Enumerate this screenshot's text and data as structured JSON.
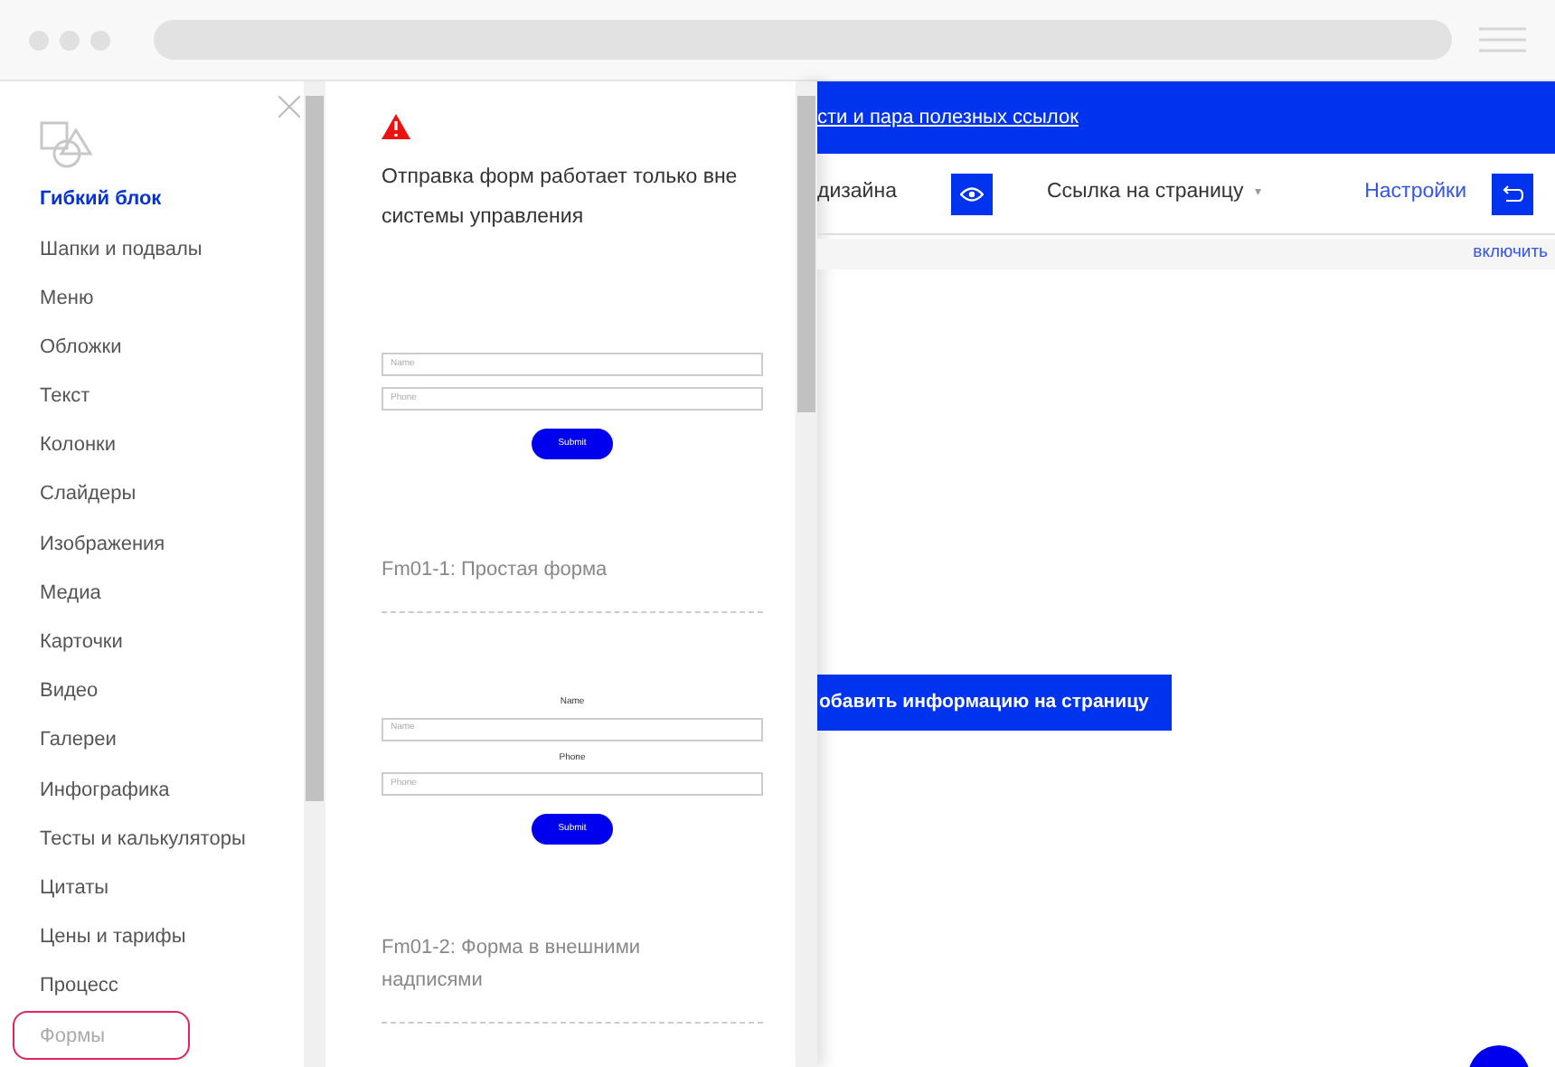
{
  "sidebar": {
    "items": [
      {
        "label": "Гибкий блок",
        "selected": true,
        "outlined": false
      },
      {
        "label": "Шапки и подвалы",
        "selected": false,
        "outlined": false
      },
      {
        "label": "Меню",
        "selected": false,
        "outlined": false
      },
      {
        "label": "Обложки",
        "selected": false,
        "outlined": false
      },
      {
        "label": "Текст",
        "selected": false,
        "outlined": false
      },
      {
        "label": "Колонки",
        "selected": false,
        "outlined": false
      },
      {
        "label": "Слайдеры",
        "selected": false,
        "outlined": false
      },
      {
        "label": "Изображения",
        "selected": false,
        "outlined": false
      },
      {
        "label": "Медиа",
        "selected": false,
        "outlined": false
      },
      {
        "label": "Карточки",
        "selected": false,
        "outlined": false
      },
      {
        "label": "Видео",
        "selected": false,
        "outlined": false
      },
      {
        "label": "Галереи",
        "selected": false,
        "outlined": false
      },
      {
        "label": "Инфографика",
        "selected": false,
        "outlined": false
      },
      {
        "label": "Тесты и калькуляторы",
        "selected": false,
        "outlined": false
      },
      {
        "label": "Цитаты",
        "selected": false,
        "outlined": false
      },
      {
        "label": "Цены и тарифы",
        "selected": false,
        "outlined": false
      },
      {
        "label": "Процесс",
        "selected": false,
        "outlined": false
      },
      {
        "label": "Формы",
        "selected": false,
        "outlined": true
      }
    ]
  },
  "panel": {
    "warning": "Отправка форм работает только вне системы управления",
    "templates": [
      {
        "kind": "simple",
        "fields": [
          {
            "placeholder": "Name"
          },
          {
            "placeholder": "Phone"
          }
        ],
        "submit": "Submit",
        "caption": "Fm01-1: Простая форма"
      },
      {
        "kind": "labeled",
        "fields": [
          {
            "label": "Name",
            "placeholder": "Name"
          },
          {
            "label": "Phone",
            "placeholder": "Phone"
          }
        ],
        "submit": "Submit",
        "caption": "Fm01-2: Форма в внешними надписями"
      }
    ]
  },
  "page": {
    "banner_link": "сти и пара полезных ссылок",
    "toolbar": {
      "design_label": "дизайна",
      "page_link": "Ссылка на страницу",
      "page_link_caret": "▾",
      "settings": "Настройки"
    },
    "strip_action": "включить",
    "add_button": "обавить информацию на страницу"
  }
}
